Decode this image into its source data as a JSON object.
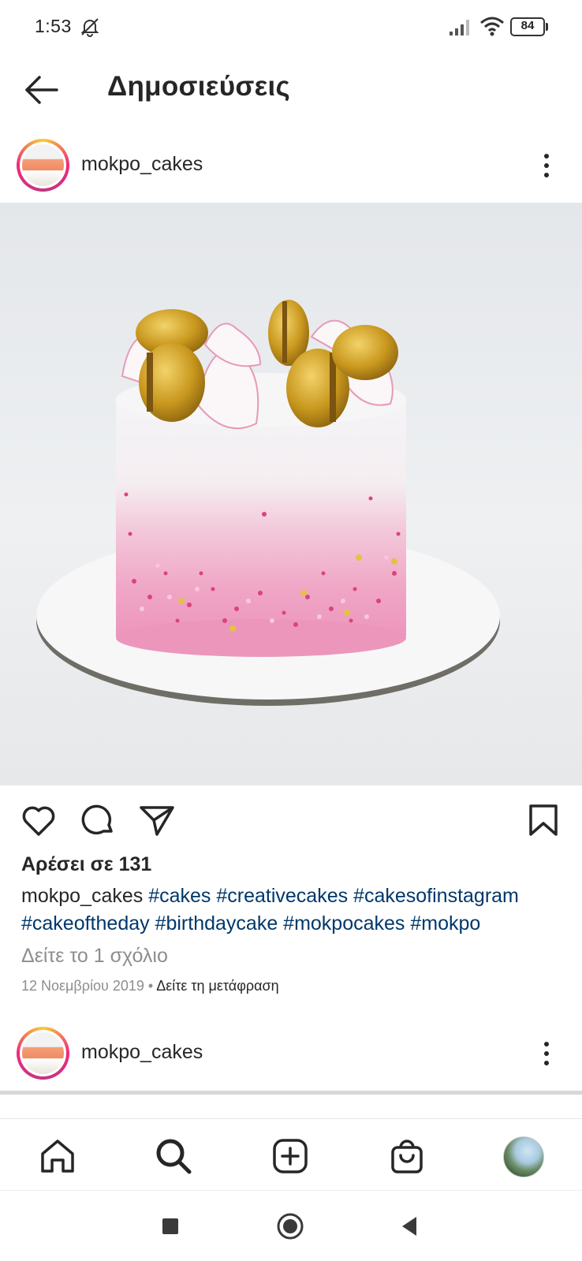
{
  "status_bar": {
    "time": "1:53",
    "battery": "84"
  },
  "header": {
    "title": "Δημοσιεύσεις"
  },
  "post": {
    "username": "mokpo_cakes",
    "likes_text": "Αρέσει σε 131",
    "caption_user": "mokpo_cakes",
    "caption_tags": "#cakes #creativecakes #cakesofinstagram #cakeoftheday #birthdaycake #mokpocakes #mokpo",
    "view_comments": "Δείτε το 1 σχόλιο",
    "date": "12 Νοεμβρίου 2019",
    "meta_separator": " • ",
    "translate_link": "Δείτε τη μετάφραση"
  },
  "next_post": {
    "username": "mokpo_cakes"
  },
  "icons": {
    "back": "arrow-left-icon",
    "more": "more-vertical-icon",
    "like": "heart-icon",
    "comment": "comment-icon",
    "share": "paper-plane-icon",
    "save": "bookmark-icon",
    "home": "home-icon",
    "search": "search-icon",
    "create": "plus-square-icon",
    "shop": "shopping-bag-icon"
  },
  "colors": {
    "text": "#262626",
    "hashtag": "#00376b",
    "muted": "#8e8e8e"
  }
}
